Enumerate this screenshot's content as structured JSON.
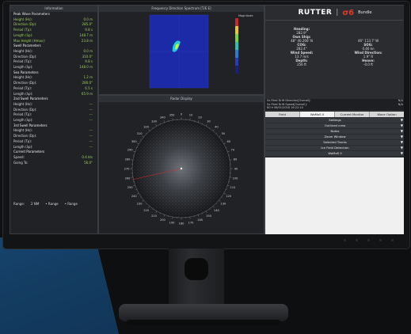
{
  "left_panel": {
    "title": "Information",
    "rows": [
      {
        "k": "Peak Wave Parameters",
        "v": "",
        "type": "head"
      },
      {
        "k": "Height (Hs):",
        "v": "0.0 m",
        "type": "g"
      },
      {
        "k": "Direction (Dp):",
        "v": "285.0°",
        "type": "g"
      },
      {
        "k": "Period (Tp):",
        "v": "9.8 s",
        "type": "g"
      },
      {
        "k": "Length (λp):",
        "v": "148.7 m",
        "type": "g"
      },
      {
        "k": "Max Height (Hmax):",
        "v": "23.8 m",
        "type": "g"
      },
      {
        "k": "Swell Parameters",
        "v": "",
        "type": "head"
      },
      {
        "k": "Height (Hs):",
        "v": "0.0 m",
        "type": ""
      },
      {
        "k": "Direction (Dp):",
        "v": "310.0°",
        "type": ""
      },
      {
        "k": "Period (Tp):",
        "v": "9.8 s",
        "type": ""
      },
      {
        "k": "Length (λp):",
        "v": "148.0 m",
        "type": ""
      },
      {
        "k": "Sea Parameters",
        "v": "",
        "type": "head"
      },
      {
        "k": "Height (Hs):",
        "v": "1.2 m",
        "type": ""
      },
      {
        "k": "Direction (Dp):",
        "v": "280.0°",
        "type": ""
      },
      {
        "k": "Period (Tp):",
        "v": "6.5 s",
        "type": ""
      },
      {
        "k": "Length (λp):",
        "v": "65.9 m",
        "type": ""
      },
      {
        "k": "2nd Swell Parameters",
        "v": "",
        "type": "head"
      },
      {
        "k": "Height (Hs):",
        "v": "---",
        "type": ""
      },
      {
        "k": "Direction (Dp):",
        "v": "---",
        "type": ""
      },
      {
        "k": "Period (Tp):",
        "v": "---",
        "type": ""
      },
      {
        "k": "Length (λp):",
        "v": "---",
        "type": ""
      },
      {
        "k": "3rd Swell Parameters",
        "v": "",
        "type": "head"
      },
      {
        "k": "Height (Hs):",
        "v": "---",
        "type": ""
      },
      {
        "k": "Direction (Dp):",
        "v": "---",
        "type": ""
      },
      {
        "k": "Period (Tp):",
        "v": "---",
        "type": ""
      },
      {
        "k": "Length (λp):",
        "v": "---",
        "type": ""
      },
      {
        "k": "Current Parameters",
        "v": "",
        "type": "head"
      },
      {
        "k": "Speed:",
        "v": "0.4 kts",
        "type": ""
      },
      {
        "k": "Going To:",
        "v": "56.0°",
        "type": ""
      }
    ],
    "range_label": "Range:",
    "range_value": "2 NM",
    "range_opt1": "• Range",
    "range_opt2": "• Range"
  },
  "freq_panel": {
    "title": "Frequency Direction Spectrum [T/E E]",
    "legend_title": "Magnitude"
  },
  "radar_panel": {
    "title": "Radar Display",
    "bearings": [
      "0",
      "10",
      "20",
      "30",
      "40",
      "50",
      "60",
      "70",
      "80",
      "90",
      "100",
      "110",
      "120",
      "130",
      "140",
      "150",
      "160",
      "170",
      "180",
      "190",
      "200",
      "210",
      "220",
      "230",
      "240",
      "250",
      "260",
      "270",
      "280",
      "290",
      "300",
      "310",
      "320",
      "330",
      "340",
      "350"
    ]
  },
  "right_panel": {
    "logo": "RUTTER",
    "logo_sigma": "σ6",
    "logo_bundle": "Bundle",
    "nav": [
      {
        "label": "Heading:",
        "value": "282.9°",
        "label2": "",
        "value2": ""
      },
      {
        "label": "Own Ship:",
        "value": "48° 40.266' N",
        "label2": "",
        "value2": "46° 113.7' W"
      },
      {
        "label": "COG:",
        "value": "282.4°",
        "label2": "SOG:",
        "value2": "0.46 kn"
      },
      {
        "label": "Wind Speed:",
        "value": "13.7 m/s",
        "label2": "Wind Direction:",
        "value2": "1.9° R"
      },
      {
        "label": "Depth:",
        "value": "256 ft",
        "label2": "Heave:",
        "value2": "-0.0 ft"
      }
    ],
    "status_lines": [
      {
        "k": "Sx Filed Drift Direction[Overall]:",
        "v": "N/A"
      },
      {
        "k": "Sx Filed Drift Speed[Overall]:",
        "v": "N/A"
      },
      {
        "k": "KO  ▾  06/01/2018 16:22:10",
        "v": ""
      }
    ],
    "tabs": [
      "Field",
      "WaMoS II",
      "Current Monitor",
      "Wave Option"
    ],
    "active_tab": 1,
    "menu": [
      "Settings",
      "Outlined crew",
      "Notes",
      "Zoom Window",
      "Selected Tracks",
      "Ice Field Detection",
      "WaMoS II"
    ]
  }
}
